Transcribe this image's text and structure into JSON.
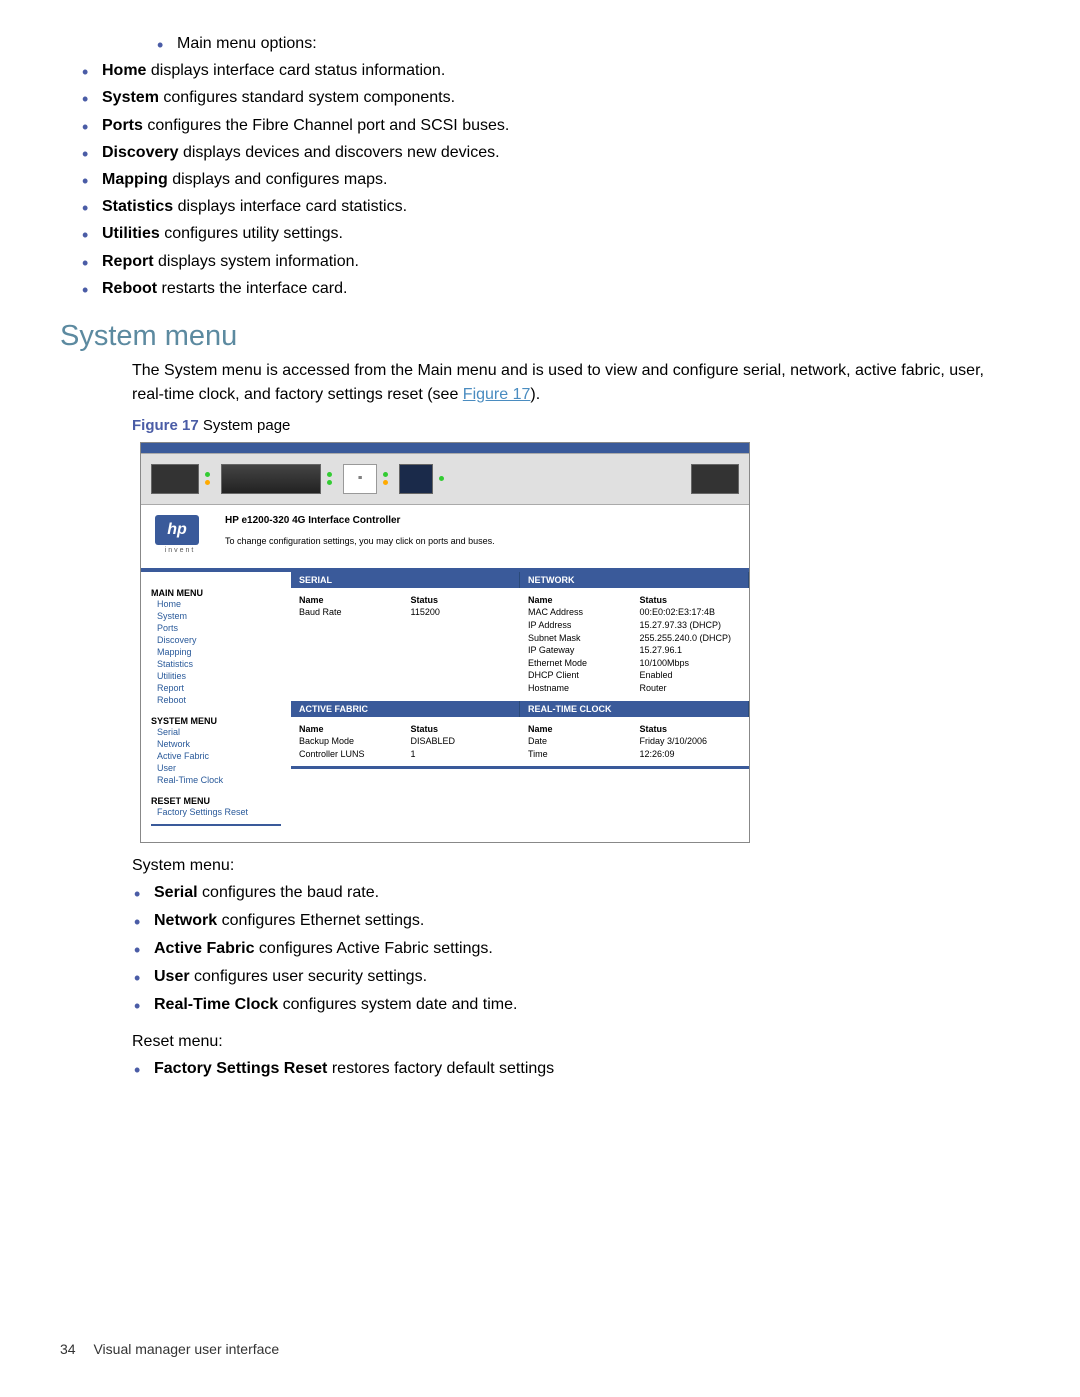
{
  "mainMenuIntro": "Main menu options:",
  "mainMenu": {
    "home": {
      "term": "Home",
      "desc": " displays interface card status information."
    },
    "system": {
      "term": "System",
      "desc": " configures standard system components."
    },
    "ports": {
      "term": "Ports",
      "desc": " configures the Fibre Channel port and SCSI buses."
    },
    "discovery": {
      "term": "Discovery",
      "desc": " displays devices and discovers new devices."
    },
    "mapping": {
      "term": "Mapping",
      "desc": " displays and configures maps."
    },
    "statistics": {
      "term": "Statistics",
      "desc": " displays interface card statistics."
    },
    "utilities": {
      "term": "Utilities",
      "desc": " configures utility settings."
    },
    "report": {
      "term": "Report",
      "desc": " displays system information."
    },
    "reboot": {
      "term": "Reboot",
      "desc": " restarts the interface card."
    }
  },
  "sectionHeading": "System menu",
  "sectionIntroPart1": "The System menu is accessed from the Main menu and is used to view and configure serial, network, active fabric, user, real-time clock, and factory settings reset (see ",
  "sectionIntroLink": "Figure 17",
  "sectionIntroPart2": ").",
  "figCaptionLabel": "Figure 17",
  "figCaptionText": " System page",
  "figure": {
    "productTitle": "HP e1200-320 4G Interface Controller",
    "productSub": "To change configuration settings, you may click on ports and buses.",
    "logoText": "hp",
    "logoSub": "invent",
    "sidebar": {
      "mainTitle": "MAIN MENU",
      "mainItems": [
        "Home",
        "System",
        "Ports",
        "Discovery",
        "Mapping",
        "Statistics",
        "Utilities",
        "Report",
        "Reboot"
      ],
      "sysTitle": "SYSTEM MENU",
      "sysItems": [
        "Serial",
        "Network",
        "Active Fabric",
        "User",
        "Real-Time Clock"
      ],
      "resetTitle": "RESET MENU",
      "resetItems": [
        "Factory Settings Reset"
      ]
    },
    "panels": {
      "serial": {
        "header": "SERIAL",
        "nameHd": "Name",
        "statHd": "Status",
        "rows": [
          {
            "n": "Baud Rate",
            "v": "115200"
          }
        ]
      },
      "network": {
        "header": "NETWORK",
        "nameHd": "Name",
        "statHd": "Status",
        "rows": [
          {
            "n": "MAC Address",
            "v": "00:E0:02:E3:17:4B"
          },
          {
            "n": "IP Address",
            "v": "15.27.97.33 (DHCP)"
          },
          {
            "n": "Subnet Mask",
            "v": "255.255.240.0 (DHCP)"
          },
          {
            "n": "IP Gateway",
            "v": "15.27.96.1"
          },
          {
            "n": "Ethernet Mode",
            "v": "10/100Mbps"
          },
          {
            "n": "DHCP Client",
            "v": "Enabled"
          },
          {
            "n": "Hostname",
            "v": "Router"
          }
        ]
      },
      "activeFabric": {
        "header": "ACTIVE FABRIC",
        "nameHd": "Name",
        "statHd": "Status",
        "rows": [
          {
            "n": "Backup Mode",
            "v": "DISABLED"
          },
          {
            "n": "Controller LUNS",
            "v": "1"
          }
        ]
      },
      "rtc": {
        "header": "REAL-TIME CLOCK",
        "nameHd": "Name",
        "statHd": "Status",
        "rows": [
          {
            "n": "Date",
            "v": "Friday 3/10/2006"
          },
          {
            "n": "Time",
            "v": "12:26:09"
          }
        ]
      }
    }
  },
  "sysMenuLabel": "System menu:",
  "sysMenu": {
    "serial": {
      "term": "Serial",
      "desc": " configures the baud rate."
    },
    "network": {
      "term": "Network",
      "desc": " configures Ethernet settings."
    },
    "af": {
      "term": "Active Fabric",
      "desc": " configures Active Fabric settings."
    },
    "user": {
      "term": "User",
      "desc": " configures user security settings."
    },
    "rtc": {
      "term": "Real-Time Clock",
      "desc": " configures system date and time."
    }
  },
  "resetMenuLabel": "Reset menu:",
  "resetMenu": {
    "fsr": {
      "term": "Factory Settings Reset",
      "desc": " restores factory default settings"
    }
  },
  "pageNumber": "34",
  "footerText": "Visual manager user interface"
}
